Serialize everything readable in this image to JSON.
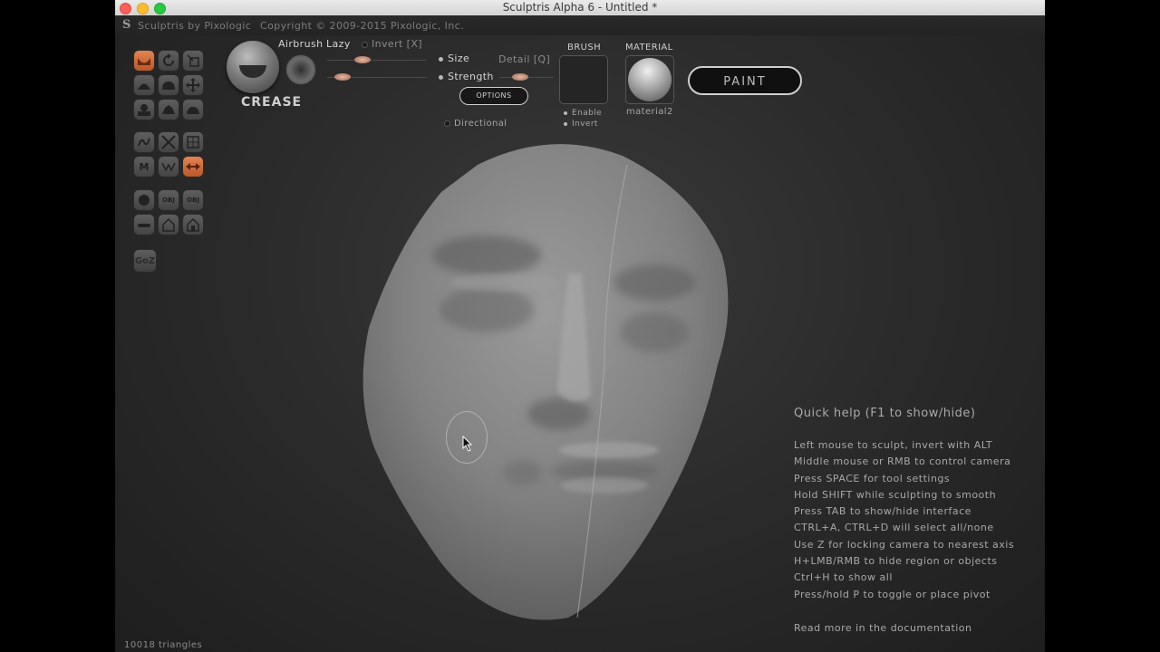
{
  "window": {
    "title": "Sculptris Alpha 6 - Untitled *"
  },
  "header": {
    "app_name": "Sculptris by Pixologic",
    "copyright": "Copyright © 2009-2015 Pixologic, Inc."
  },
  "tools": {
    "goz_label": "GoZ",
    "obj_label": "OBJ",
    "mirror_label": "M"
  },
  "brush": {
    "name": "CREASE",
    "airbrush_label": "Airbrush",
    "lazy_label": "Lazy",
    "invert_label": "Invert [X]",
    "size_label": "Size",
    "strength_label": "Strength",
    "detail_label": "Detail [Q]",
    "options_label": "OPTIONS",
    "directional_label": "Directional"
  },
  "brush_panel": {
    "title": "BRUSH",
    "enable_label": "Enable",
    "invert_label": "Invert"
  },
  "material_panel": {
    "title": "MATERIAL",
    "material_name": "material2"
  },
  "paint_button": {
    "label": "PAINT"
  },
  "quick_help": {
    "title": "Quick help (F1 to show/hide)",
    "lines": [
      "Left mouse to sculpt, invert with ALT",
      "Middle mouse or RMB to control camera",
      "Press SPACE for tool settings",
      "Hold SHIFT while sculpting to smooth",
      "Press TAB to show/hide interface",
      "CTRL+A, CTRL+D will select all/none",
      "Use Z for locking camera to nearest axis",
      "H+LMB/RMB to hide region or objects",
      "Ctrl+H to show all",
      "Press/hold P to toggle or place pivot"
    ],
    "more": "Read more in the documentation"
  },
  "status": {
    "triangles": "10018 triangles"
  },
  "colors": {
    "accent": "#d46e3c",
    "background": "#2c2c2c",
    "text": "#a8a8a8"
  }
}
